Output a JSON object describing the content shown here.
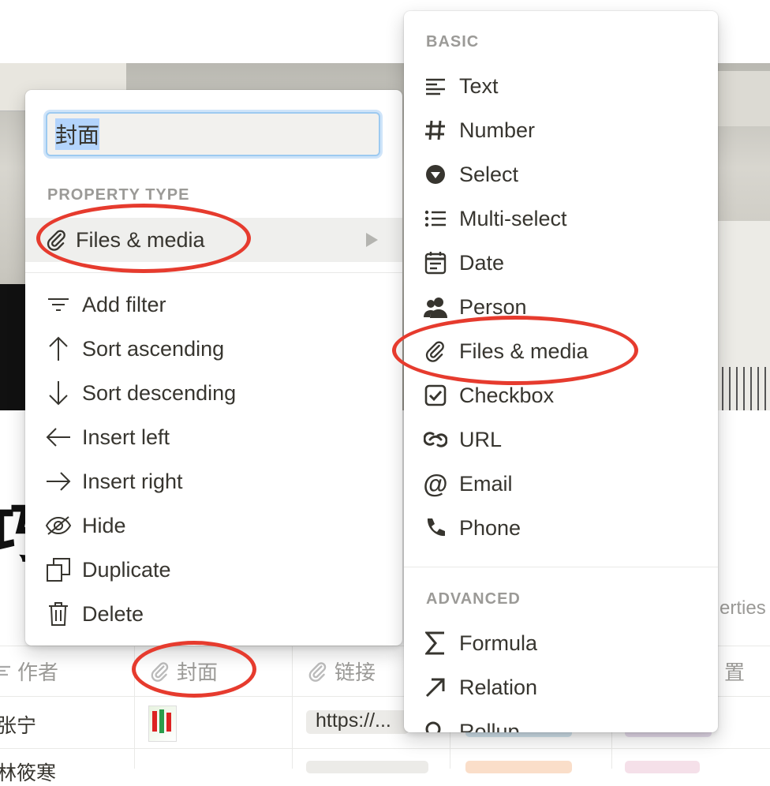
{
  "left_menu": {
    "name_value": "封面",
    "property_type_label": "PROPERTY TYPE",
    "current_type": "Files & media",
    "actions": [
      {
        "label": "Add filter",
        "icon": "filter-icon"
      },
      {
        "label": "Sort ascending",
        "icon": "arrow-up-icon"
      },
      {
        "label": "Sort descending",
        "icon": "arrow-down-icon"
      },
      {
        "label": "Insert left",
        "icon": "arrow-left-icon"
      },
      {
        "label": "Insert right",
        "icon": "arrow-right-icon"
      },
      {
        "label": "Hide",
        "icon": "eye-slash-icon"
      },
      {
        "label": "Duplicate",
        "icon": "duplicate-icon"
      },
      {
        "label": "Delete",
        "icon": "trash-icon"
      }
    ]
  },
  "type_menu": {
    "basic_label": "BASIC",
    "basic_items": [
      {
        "label": "Text",
        "icon": "text-lines-icon"
      },
      {
        "label": "Number",
        "icon": "hash-icon"
      },
      {
        "label": "Select",
        "icon": "select-circle-icon"
      },
      {
        "label": "Multi-select",
        "icon": "bullet-list-icon"
      },
      {
        "label": "Date",
        "icon": "calendar-icon"
      },
      {
        "label": "Person",
        "icon": "person-icon"
      },
      {
        "label": "Files & media",
        "icon": "paperclip-icon"
      },
      {
        "label": "Checkbox",
        "icon": "checkbox-icon"
      },
      {
        "label": "URL",
        "icon": "link-icon"
      },
      {
        "label": "Email",
        "icon": "at-icon"
      },
      {
        "label": "Phone",
        "icon": "phone-icon"
      }
    ],
    "advanced_label": "ADVANCED",
    "advanced_items": [
      {
        "label": "Formula",
        "icon": "sigma-icon"
      },
      {
        "label": "Relation",
        "icon": "arrow-up-right-icon"
      },
      {
        "label": "Rollup",
        "icon": "search-icon"
      }
    ]
  },
  "table": {
    "headers": [
      "作者",
      "封面",
      "链接",
      "置"
    ],
    "rows": [
      {
        "author": "张宁",
        "link": "https://..."
      },
      {
        "author": "林筱寒"
      }
    ]
  },
  "background": {
    "title_fragment": "巧",
    "properties_fragment": "erties"
  },
  "colors": {
    "annotation_red": "#e63b2e",
    "focus_blue": "#9dcaf0"
  }
}
